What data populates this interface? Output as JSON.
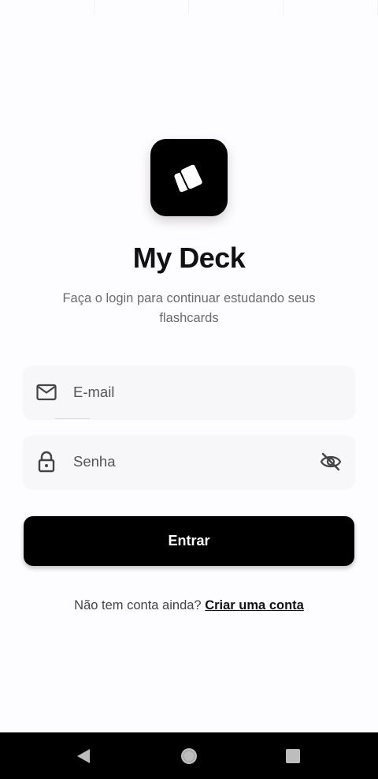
{
  "app": {
    "title": "My Deck",
    "subtitle": "Faça o login para continuar estudando seus flashcards",
    "logo_icon": "cards-icon"
  },
  "form": {
    "email": {
      "placeholder": "E-mail",
      "value": "",
      "icon": "mail-icon"
    },
    "password": {
      "placeholder": "Senha",
      "value": "",
      "icon": "lock-icon",
      "toggle_icon": "eye-off-icon"
    },
    "submit_label": "Entrar"
  },
  "signup": {
    "prompt": "Não tem conta ainda?",
    "link_label": "Criar uma conta"
  },
  "colors": {
    "background": "#fdfcfe",
    "primary": "#000000",
    "field_background": "#f7f6f8",
    "subtitle_text": "#6b6b6b"
  },
  "navigation": {
    "back_icon": "back-triangle-icon",
    "home_icon": "home-circle-icon",
    "recents_icon": "recents-square-icon"
  }
}
